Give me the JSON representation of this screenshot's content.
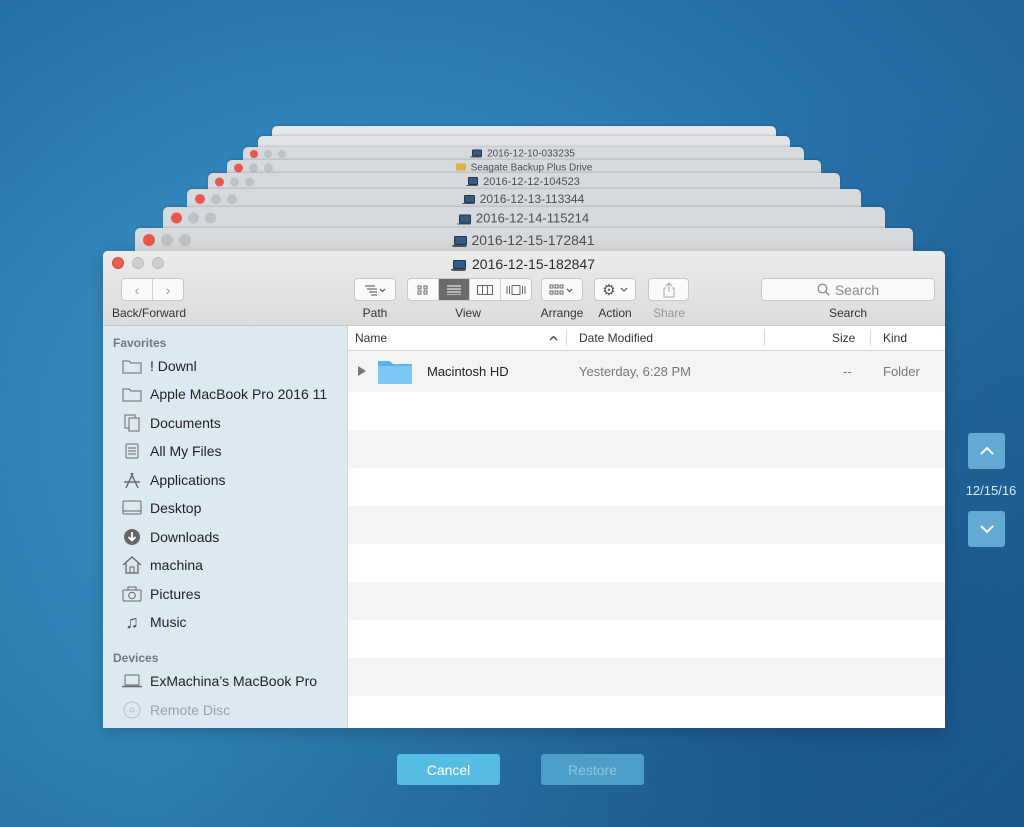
{
  "stack_windows": [
    {
      "title": ""
    },
    {
      "title": ""
    },
    {
      "title": "2016-12-10-033235",
      "icon": "laptop-icon"
    },
    {
      "title": "Seagate Backup Plus Drive",
      "icon": "drive-icon"
    },
    {
      "title": "2016-12-12-104523",
      "icon": "laptop-icon"
    },
    {
      "title": "2016-12-13-113344",
      "icon": "laptop-icon"
    },
    {
      "title": "2016-12-14-115214",
      "icon": "laptop-icon"
    },
    {
      "title": "2016-12-15-172841",
      "icon": "laptop-icon"
    }
  ],
  "window": {
    "title": "2016-12-15-182847"
  },
  "toolbar": {
    "back_forward_label": "Back/Forward",
    "path_label": "Path",
    "view_label": "View",
    "arrange_label": "Arrange",
    "action_label": "Action",
    "share_label": "Share",
    "search_label": "Search",
    "search_placeholder": "Search"
  },
  "sidebar": {
    "favorites_heading": "Favorites",
    "favorites": [
      {
        "label": "! Downl",
        "icon": "folder-icon"
      },
      {
        "label": "Apple MacBook Pro 2016 11",
        "icon": "folder-icon"
      },
      {
        "label": "Documents",
        "icon": "documents-icon"
      },
      {
        "label": "All My Files",
        "icon": "all-files-icon"
      },
      {
        "label": "Applications",
        "icon": "applications-icon"
      },
      {
        "label": "Desktop",
        "icon": "desktop-icon"
      },
      {
        "label": "Downloads",
        "icon": "downloads-icon"
      },
      {
        "label": "machina",
        "icon": "home-icon"
      },
      {
        "label": "Pictures",
        "icon": "camera-icon"
      },
      {
        "label": "Music",
        "icon": "music-note-icon"
      }
    ],
    "devices_heading": "Devices",
    "devices": [
      {
        "label": "ExMachina’s MacBook Pro",
        "icon": "laptop-icon"
      },
      {
        "label": "Remote Disc",
        "icon": "disc-icon"
      }
    ]
  },
  "list": {
    "columns": {
      "name": "Name",
      "date": "Date Modified",
      "size": "Size",
      "kind": "Kind"
    },
    "files": [
      {
        "name": "Macintosh HD",
        "date": "Yesterday, 6:28 PM",
        "size": "--",
        "kind": "Folder"
      }
    ]
  },
  "timemachine": {
    "date": "12/15/16"
  },
  "buttons": {
    "cancel": "Cancel",
    "restore": "Restore"
  },
  "colors": {
    "accent": "#55bde4",
    "close_red": "#ee5c53",
    "sidebar_bg": "#dde9f1"
  }
}
